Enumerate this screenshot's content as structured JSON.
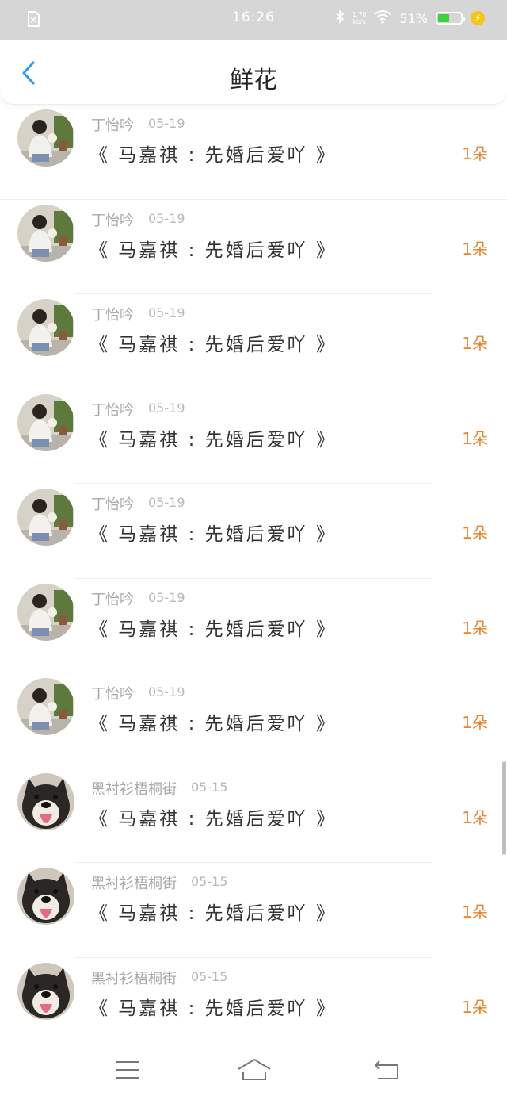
{
  "status_bar": {
    "time": "16:26",
    "net_speed": "1.70",
    "net_unit": "kb/s",
    "battery": "51%",
    "battery_level": 0.51
  },
  "header": {
    "title": "鲜花"
  },
  "items": [
    {
      "user": "丁怡吟",
      "date": "05-19",
      "book": "《 马嘉祺 : 先婚后爱吖 》",
      "count": "1朵",
      "avatar": "girl-photo"
    },
    {
      "user": "丁怡吟",
      "date": "05-19",
      "book": "《 马嘉祺 : 先婚后爱吖 》",
      "count": "1朵",
      "avatar": "girl-photo"
    },
    {
      "user": "丁怡吟",
      "date": "05-19",
      "book": "《 马嘉祺 : 先婚后爱吖 》",
      "count": "1朵",
      "avatar": "girl-photo"
    },
    {
      "user": "丁怡吟",
      "date": "05-19",
      "book": "《 马嘉祺 : 先婚后爱吖 》",
      "count": "1朵",
      "avatar": "girl-photo"
    },
    {
      "user": "丁怡吟",
      "date": "05-19",
      "book": "《 马嘉祺 : 先婚后爱吖 》",
      "count": "1朵",
      "avatar": "girl-photo"
    },
    {
      "user": "丁怡吟",
      "date": "05-19",
      "book": "《 马嘉祺 : 先婚后爱吖 》",
      "count": "1朵",
      "avatar": "girl-photo"
    },
    {
      "user": "丁怡吟",
      "date": "05-19",
      "book": "《 马嘉祺 : 先婚后爱吖 》",
      "count": "1朵",
      "avatar": "girl-photo"
    },
    {
      "user": "黑衬衫梧桐街",
      "date": "05-15",
      "book": "《 马嘉祺 : 先婚后爱吖 》",
      "count": "1朵",
      "avatar": "dog-photo"
    },
    {
      "user": "黑衬衫梧桐街",
      "date": "05-15",
      "book": "《 马嘉祺 : 先婚后爱吖 》",
      "count": "1朵",
      "avatar": "dog-photo"
    },
    {
      "user": "黑衬衫梧桐街",
      "date": "05-15",
      "book": "《 马嘉祺 : 先婚后爱吖 》",
      "count": "1朵",
      "avatar": "dog-photo"
    }
  ],
  "colors": {
    "accent_blue": "#2b9af3",
    "count_orange": "#e8832e",
    "status_bar_bg": "#d6d6d6"
  },
  "icons": {
    "back": "chevron-left-icon",
    "menu": "menu-icon",
    "home": "home-icon",
    "return": "return-icon"
  }
}
